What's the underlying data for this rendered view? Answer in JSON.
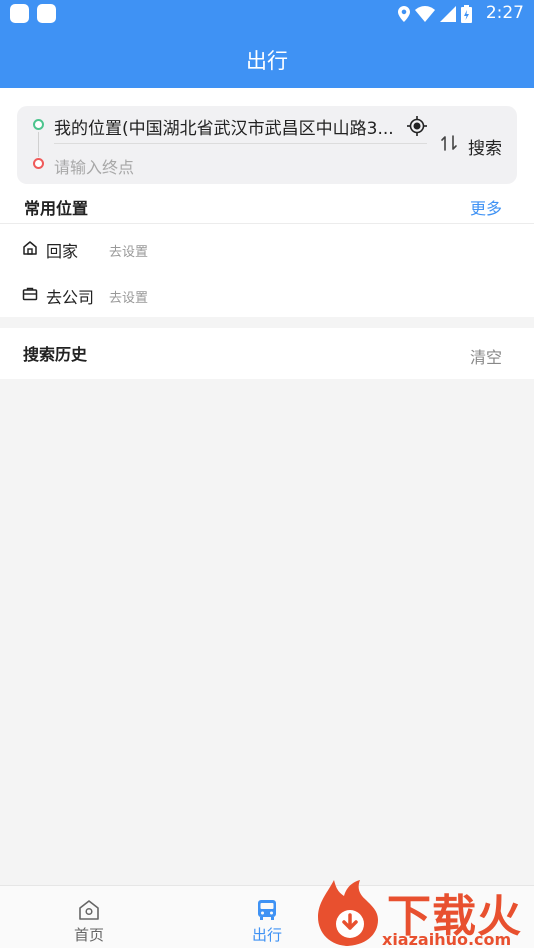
{
  "status_bar": {
    "time": "2:27",
    "icons": [
      "location-icon",
      "wifi-icon",
      "signal-icon",
      "battery-icon"
    ]
  },
  "header": {
    "title": "出行"
  },
  "route": {
    "origin": "我的位置(中国湖北省武汉市武昌区中山路3...",
    "destination_placeholder": "请输入终点",
    "search_label": "搜索"
  },
  "frequent": {
    "title": "常用位置",
    "more_label": "更多",
    "items": [
      {
        "label": "回家",
        "action": "去设置",
        "icon": "home-icon"
      },
      {
        "label": "去公司",
        "action": "去设置",
        "icon": "briefcase-icon"
      }
    ]
  },
  "history": {
    "title": "搜索历史",
    "clear_label": "清空"
  },
  "tabs": [
    {
      "label": "首页",
      "icon": "home-tab-icon",
      "active": false
    },
    {
      "label": "出行",
      "icon": "bus-icon",
      "active": true
    }
  ],
  "watermark": {
    "text": "下载火",
    "url_text": "xiazaihuo.com"
  },
  "colors": {
    "primary": "#3f92f4",
    "start_dot": "#4cc48d",
    "end_dot": "#ef5a5a",
    "watermark": "#e8502f"
  }
}
